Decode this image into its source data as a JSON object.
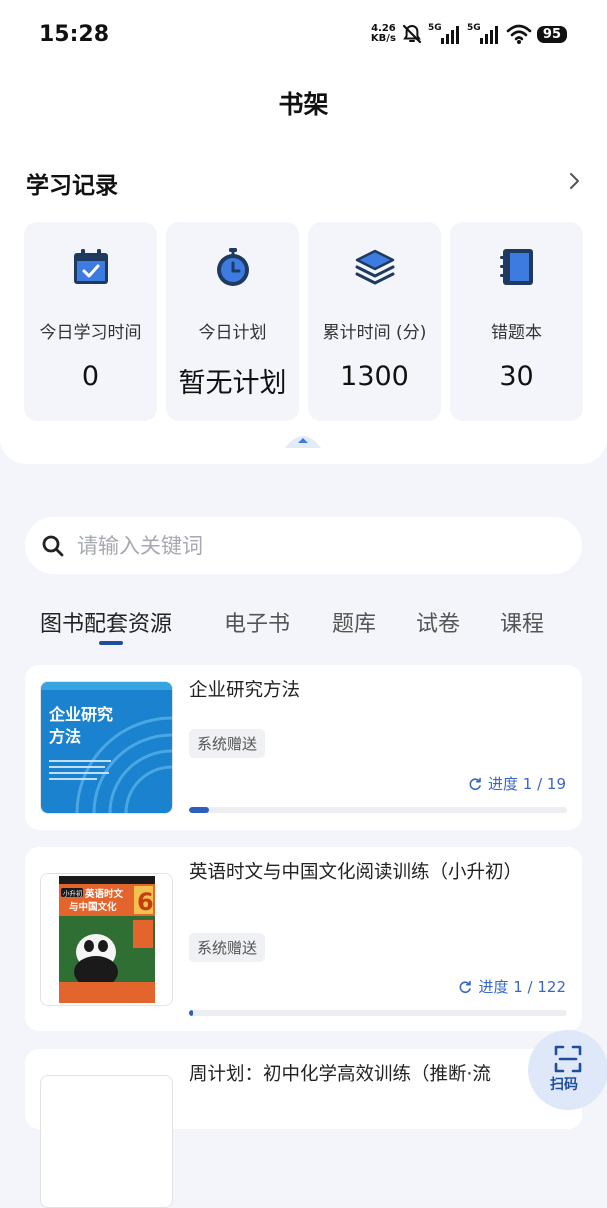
{
  "status_bar": {
    "time": "15:28",
    "net_speed_value": "4.26",
    "net_speed_unit": "KB/s",
    "signal_1_label": "5G",
    "signal_2_label": "5G",
    "battery": "95"
  },
  "header": {
    "title": "书架"
  },
  "study_record": {
    "title": "学习记录",
    "stats": [
      {
        "icon": "calendar-check-icon",
        "label": "今日学习时间",
        "value": "0"
      },
      {
        "icon": "stopwatch-icon",
        "label": "今日计划",
        "value": "暂无计划"
      },
      {
        "icon": "layers-icon",
        "label": "累计时间 (分)",
        "value": "1300"
      },
      {
        "icon": "notebook-icon",
        "label": "错题本",
        "value": "30"
      }
    ]
  },
  "search": {
    "placeholder": "请输入关键词"
  },
  "tabs": [
    {
      "label": "图书配套资源",
      "active": true
    },
    {
      "label": "电子书",
      "active": false
    },
    {
      "label": "题库",
      "active": false
    },
    {
      "label": "试卷",
      "active": false
    },
    {
      "label": "课程",
      "active": false
    }
  ],
  "books": [
    {
      "title": "企业研究方法",
      "badge": "系统赠送",
      "progress_label": "进度 1 / 19",
      "progress": 0.053,
      "cover_title_line1": "企业研究",
      "cover_title_line2": "方法"
    },
    {
      "title": "英语时文与中国文化阅读训练（小升初）",
      "badge": "系统赠送",
      "progress_label": "进度 1 / 122",
      "progress": 0.008,
      "cover_tag": "小升初",
      "cover_title_line1": "英语时文",
      "cover_title_line2": "与中国文化",
      "cover_number": "6"
    },
    {
      "title": "周计划：初中化学高效训练（推断·流"
    }
  ],
  "fab": {
    "label": "扫码"
  },
  "colors": {
    "accent": "#1f4e9c",
    "progress": "#2c5fbe",
    "progress_text": "#3a67c6",
    "icon": "#1e3a5f",
    "icon_highlight": "#3d7be0",
    "background": "#f3f5fa"
  }
}
